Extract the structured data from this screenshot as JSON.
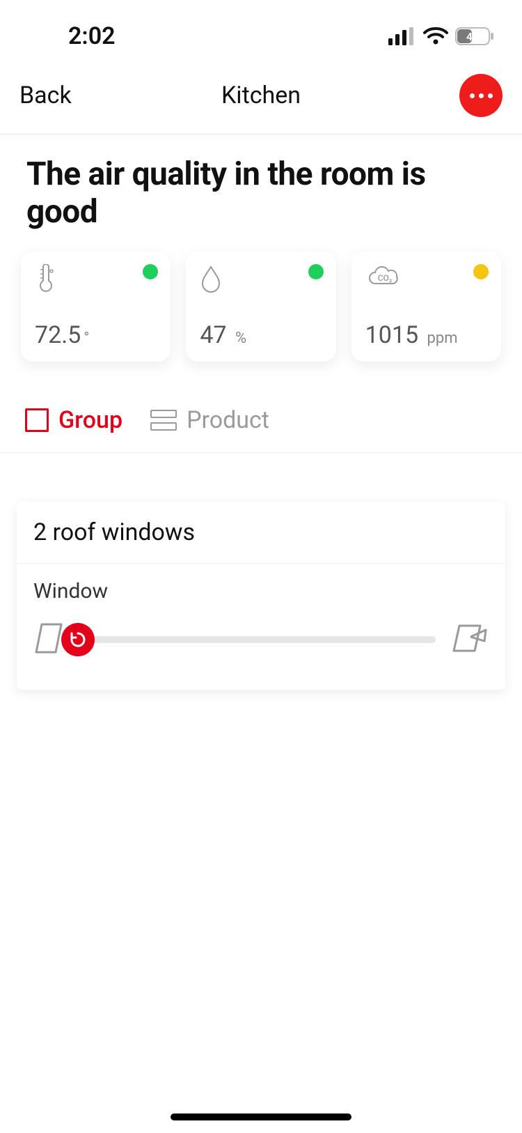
{
  "status": {
    "time": "2:02",
    "battery": "45"
  },
  "nav": {
    "back": "Back",
    "title": "Kitchen"
  },
  "headline": "The air quality in the room is good",
  "metrics": {
    "temperature": {
      "value": "72.5",
      "unit": "°",
      "status_color": "green"
    },
    "humidity": {
      "value": "47",
      "unit": "%",
      "status_color": "green"
    },
    "co2": {
      "value": "1015",
      "unit": "ppm",
      "status_color": "yellow"
    }
  },
  "tabs": {
    "group": "Group",
    "product": "Product",
    "active": "group"
  },
  "panel": {
    "title": "2 roof windows",
    "item_label": "Window",
    "slider_position_pct": 0
  },
  "colors": {
    "accent": "#e2001a",
    "fab": "#ef1c1c",
    "green": "#1fcf5c",
    "yellow": "#f4c60f"
  }
}
